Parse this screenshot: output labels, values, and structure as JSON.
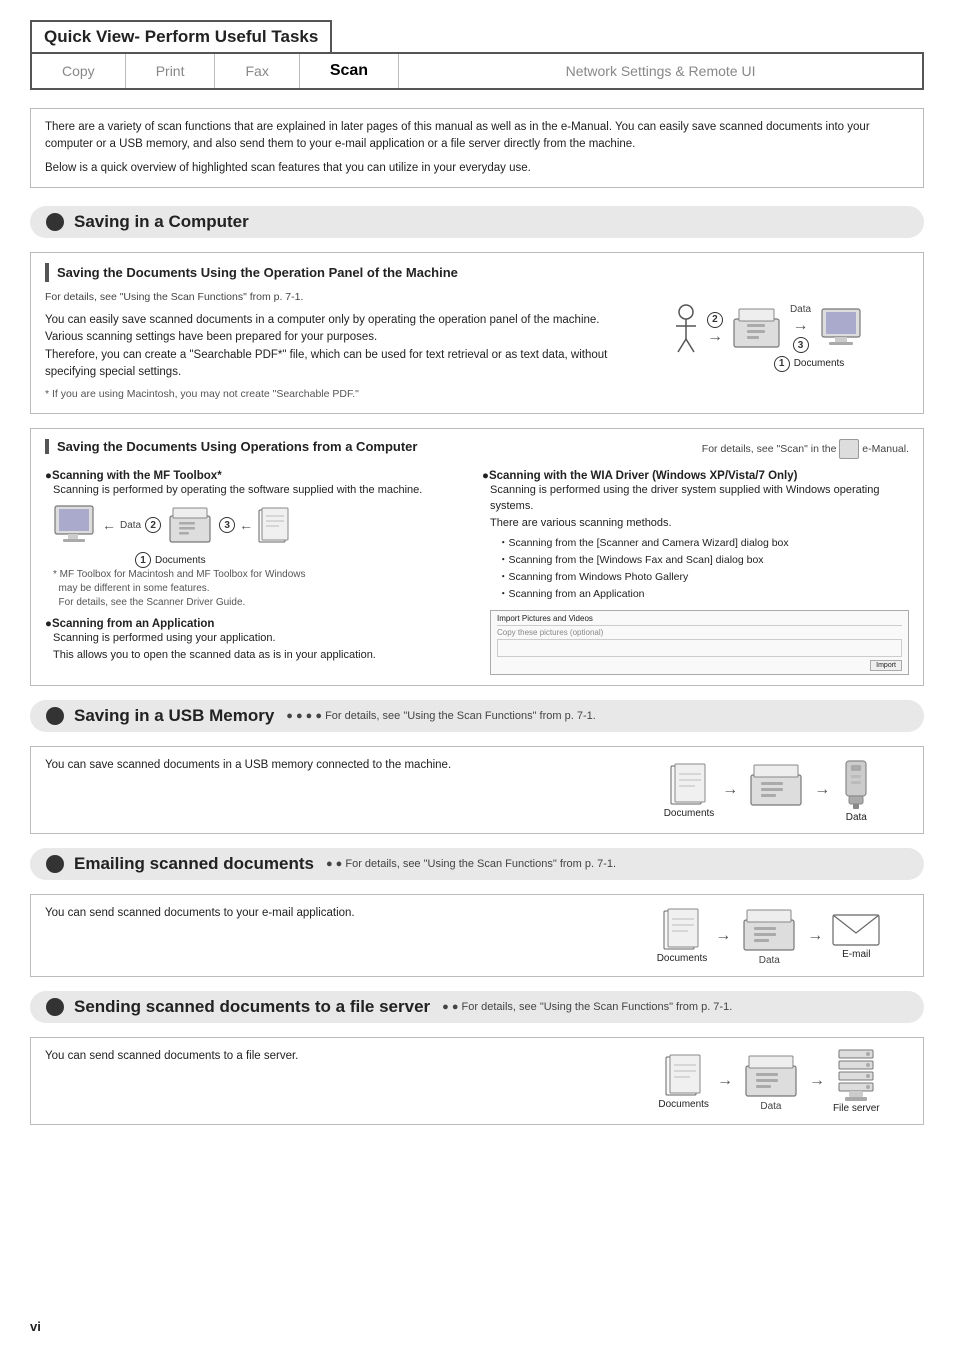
{
  "header": {
    "title": "Quick View- Perform Useful Tasks",
    "tabs": [
      {
        "label": "Copy",
        "active": false
      },
      {
        "label": "Print",
        "active": false
      },
      {
        "label": "Fax",
        "active": false
      },
      {
        "label": "Scan",
        "active": true
      },
      {
        "label": "Network Settings & Remote UI",
        "active": false
      }
    ]
  },
  "intro": {
    "para1": "There are a variety of scan functions that are explained in later pages of this manual as well as in the e-Manual. You can easily save scanned documents into your computer or a USB memory, and also send them to your e-mail application or a file server directly from the machine.",
    "para2": "Below is a quick overview of highlighted scan features that you can utilize in your everyday use."
  },
  "sections": [
    {
      "id": "saving-computer",
      "title": "Saving in a Computer",
      "note": "",
      "subsections": [
        {
          "title": "Saving the Documents Using the Operation Panel of the Machine",
          "for_details": "For details, see \"Using the Scan Functions\" from p. 7-1.",
          "body": "You can easily save scanned documents in a computer only by operating the operation panel of the machine.\nVarious scanning settings have been prepared for your purposes.\nTherefore, you can create a \"Searchable PDF*\" file, which can be used for text retrieval or as text data, without specifying special settings.",
          "note": "* If you are using Macintosh, you may not create \"Searchable PDF.\""
        },
        {
          "title": "Saving the Documents Using Operations from a Computer",
          "for_details": "For details, see \"Scan\" in the e-Manual.",
          "scanning_toolbox": {
            "heading": "●Scanning with the MF Toolbox*",
            "body": "Scanning is performed by operating the software supplied with the machine.",
            "note": "* MF Toolbox for Macintosh and MF Toolbox for Windows may be different in some features.\n  For details, see the Scanner Driver Guide."
          },
          "scanning_application": {
            "heading": "●Scanning from an Application",
            "body": "Scanning is performed using your application.\nThis allows you to open the scanned data as is in your application."
          },
          "scanning_wia": {
            "heading": "●Scanning with the WIA Driver (Windows XP/Vista/7 Only)",
            "body": "Scanning is performed using the driver system supplied with Windows operating systems.\nThere are various scanning methods.",
            "list": [
              "Scanning from the [Scanner and Camera Wizard] dialog box",
              "Scanning from the [Windows Fax and Scan] dialog box",
              "Scanning from Windows Photo Gallery",
              "Scanning from an Application"
            ]
          }
        }
      ]
    },
    {
      "id": "saving-usb",
      "title": "Saving in a USB Memory",
      "note": "● ● ● ● For details, see \"Using the Scan Functions\" from p. 7-1.",
      "body": "You can save scanned documents in a USB memory connected to the machine.",
      "diagram_labels": [
        "Documents",
        "Data"
      ]
    },
    {
      "id": "emailing",
      "title": "Emailing scanned documents",
      "note": "● ● For details, see \"Using the Scan Functions\" from p. 7-1.",
      "body": "You can send scanned documents to your e-mail application.",
      "diagram_labels": [
        "Documents",
        "Data",
        "E-mail"
      ]
    },
    {
      "id": "file-server",
      "title": "Sending scanned documents to a file server",
      "note": "● ● For details, see \"Using the Scan Functions\" from p. 7-1.",
      "body": "You can send scanned documents to a file server.",
      "diagram_labels": [
        "Documents",
        "Data",
        "File server"
      ]
    }
  ],
  "page_number": "vi"
}
